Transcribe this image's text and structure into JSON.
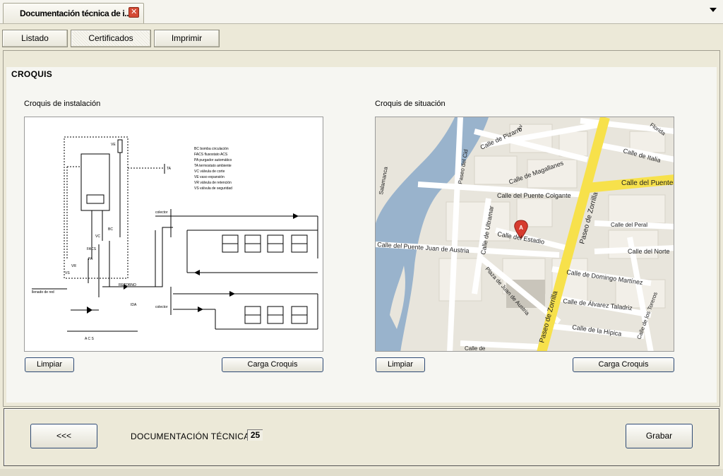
{
  "window": {
    "doc_tab_title": "Documentación técnica de i...",
    "close_glyph": "✕"
  },
  "tabs": [
    {
      "label": "Listado"
    },
    {
      "label": "Certificados",
      "active": true
    },
    {
      "label": "Imprimir"
    }
  ],
  "section": {
    "title": "CROQUIS"
  },
  "installation_panel": {
    "label": "Croquis de instalación",
    "clear_label": "Limpiar",
    "load_label": "Carga Croquis",
    "legend": [
      "BC bomba circulación",
      "FACS flusostato ACS",
      "PA purgador automático",
      "TA termostato ambiente",
      "VC válvula de corte",
      "VE vaso expansión",
      "VR válvula de retención",
      "VS válvula de seguridad"
    ],
    "labels": {
      "ve": "VE",
      "bc": "BC",
      "ta": "TA",
      "vc": "VC",
      "facs": "FACS",
      "pa": "PA",
      "vr": "VR",
      "vs": "VS",
      "colector": "colector",
      "retorno": "RETORNO",
      "ida": "IDA",
      "llenado": "llenado de red",
      "acs": "A C S"
    }
  },
  "situation_panel": {
    "label": "Croquis de situación",
    "clear_label": "Limpiar",
    "load_label": "Carga Croquis",
    "map": {
      "marker_label": "A",
      "streets": [
        "Calle de Pizarro",
        "Calle de Magallanes",
        "Calle del Puente Colgante",
        "Calle del Puente",
        "Calle de Italia",
        "Calle del Peral",
        "Calle del Norte",
        "Calle del Estadio",
        "Calle del Puente Juan de Austria",
        "Calle de Ultramar",
        "Paseo de Zorrilla",
        "Calle de Domingo Martínez",
        "Calle de Álvarez Taladriz",
        "Calle de la Hípica",
        "Calle de los Toreros",
        "Plaza de Juan de Austria",
        "Paseo del Cid",
        "Salamanca",
        "Av",
        "Florida",
        "Calle de"
      ]
    }
  },
  "footer": {
    "back_label": "<<<",
    "doc_label": "DOCUMENTACIÓN TÉCNICA",
    "page_number": "25",
    "save_label": "Grabar"
  }
}
